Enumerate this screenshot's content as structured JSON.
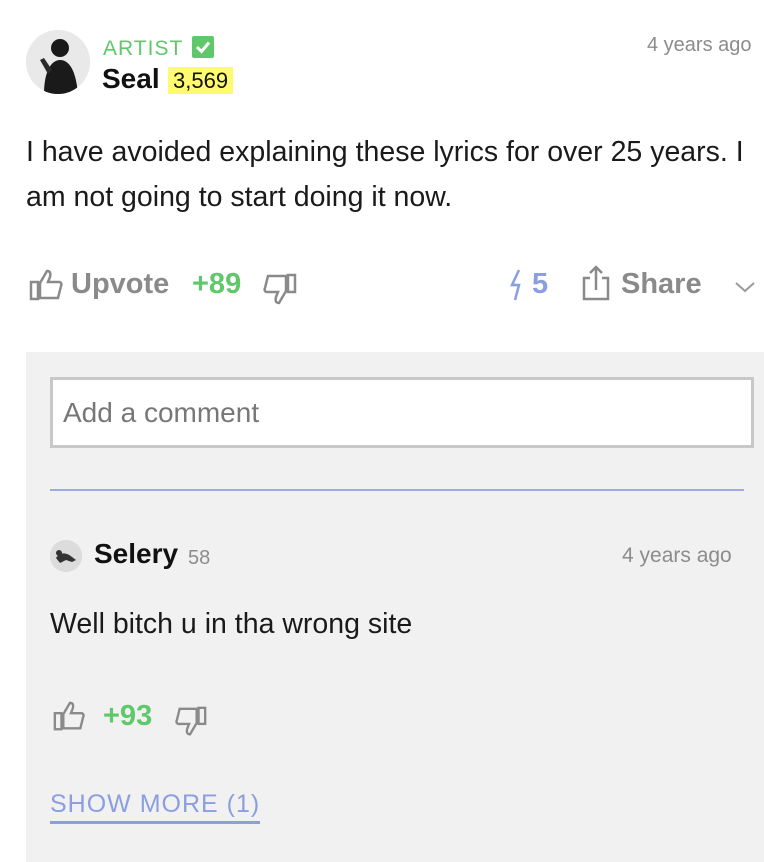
{
  "annotation": {
    "author_role": "ARTIST",
    "author_name": "Seal",
    "author_iq": "3,569",
    "timestamp": "4 years ago",
    "body": "I have avoided explaining these lyrics for over 25 years. I am not going to start doing it now.",
    "actions": {
      "upvote_label": "Upvote",
      "vote_count": "+89",
      "pyong_count": "5",
      "share_label": "Share"
    }
  },
  "comments": {
    "input_placeholder": "Add a comment",
    "items": [
      {
        "author": "Selery",
        "iq": "58",
        "timestamp": "4 years ago",
        "text": "Well bitch u in tha wrong site",
        "vote_count": "+93"
      }
    ],
    "show_more_label": "SHOW MORE (1)"
  },
  "colors": {
    "accent_green": "#5fc86a",
    "accent_blue": "#8a9ee0",
    "iq_highlight": "#fffb6e",
    "panel_bg": "#f1f1f1"
  }
}
